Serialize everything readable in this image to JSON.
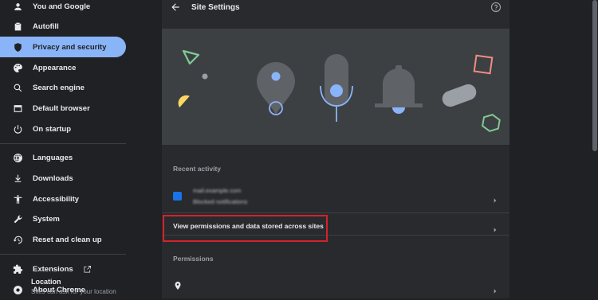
{
  "sidebar": {
    "items": [
      {
        "label": "You and Google",
        "icon": "person-icon"
      },
      {
        "label": "Autofill",
        "icon": "clipboard-icon"
      },
      {
        "label": "Privacy and security",
        "icon": "shield-icon",
        "selected": true
      },
      {
        "label": "Appearance",
        "icon": "palette-icon"
      },
      {
        "label": "Search engine",
        "icon": "search-icon"
      },
      {
        "label": "Default browser",
        "icon": "browser-icon"
      },
      {
        "label": "On startup",
        "icon": "power-icon"
      },
      {
        "label": "Languages",
        "icon": "globe-icon"
      },
      {
        "label": "Downloads",
        "icon": "download-icon"
      },
      {
        "label": "Accessibility",
        "icon": "accessibility-icon"
      },
      {
        "label": "System",
        "icon": "wrench-icon"
      },
      {
        "label": "Reset and clean up",
        "icon": "history-icon"
      },
      {
        "label": "Extensions",
        "icon": "puzzle-icon"
      },
      {
        "label": "About Chrome",
        "icon": "chrome-icon"
      }
    ]
  },
  "header": {
    "title": "Site Settings"
  },
  "recent_activity": {
    "label": "Recent activity",
    "site_name_blurred": "mail.example.com",
    "site_detail_blurred": "Blocked notifications"
  },
  "view_permissions": {
    "label": "View permissions and data stored across sites"
  },
  "permissions": {
    "label": "Permissions",
    "location": {
      "title": "Location",
      "subtitle": "Sites can ask for your location"
    }
  },
  "colors": {
    "accent": "#8ab4f8",
    "highlight_border": "#d4222d",
    "background": "#202124",
    "panel": "#292a2d"
  }
}
